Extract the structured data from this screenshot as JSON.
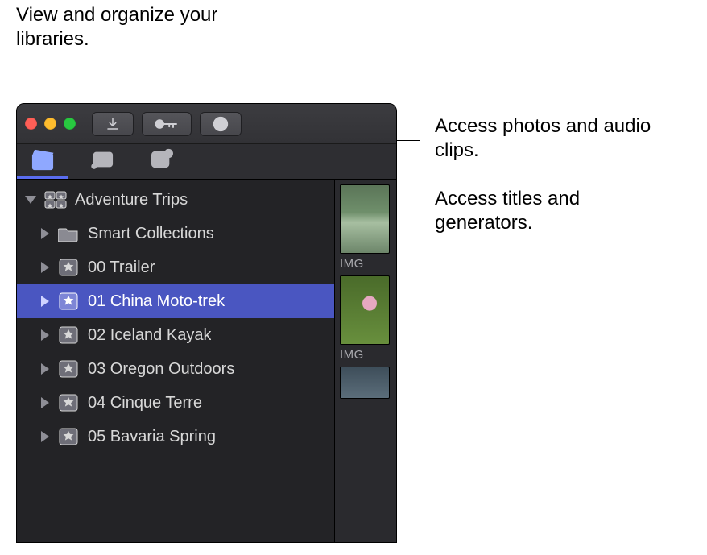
{
  "callouts": {
    "libraries": "View and organize your libraries.",
    "media": "Access photos and audio clips.",
    "titles": "Access titles and generators."
  },
  "titlebar": {
    "buttons": {
      "import": "import-arrow",
      "keyword": "keyword-editor-key",
      "background": "background-tasks-check"
    }
  },
  "tabs": {
    "libraries": "Libraries",
    "media": "Photos and Audio",
    "titles": "Titles and Generators"
  },
  "sidebar": {
    "library": {
      "name": "Adventure Trips"
    },
    "items": [
      {
        "label": "Smart Collections",
        "icon": "folder"
      },
      {
        "label": "00 Trailer",
        "icon": "event"
      },
      {
        "label": "01 China Moto-trek",
        "icon": "event",
        "selected": true
      },
      {
        "label": "02 Iceland Kayak",
        "icon": "event"
      },
      {
        "label": "03 Oregon Outdoors",
        "icon": "event"
      },
      {
        "label": "04 Cinque Terre",
        "icon": "event"
      },
      {
        "label": "05 Bavaria Spring",
        "icon": "event"
      }
    ]
  },
  "browser": {
    "clips": [
      {
        "label": "IMG"
      },
      {
        "label": "IMG"
      }
    ]
  }
}
